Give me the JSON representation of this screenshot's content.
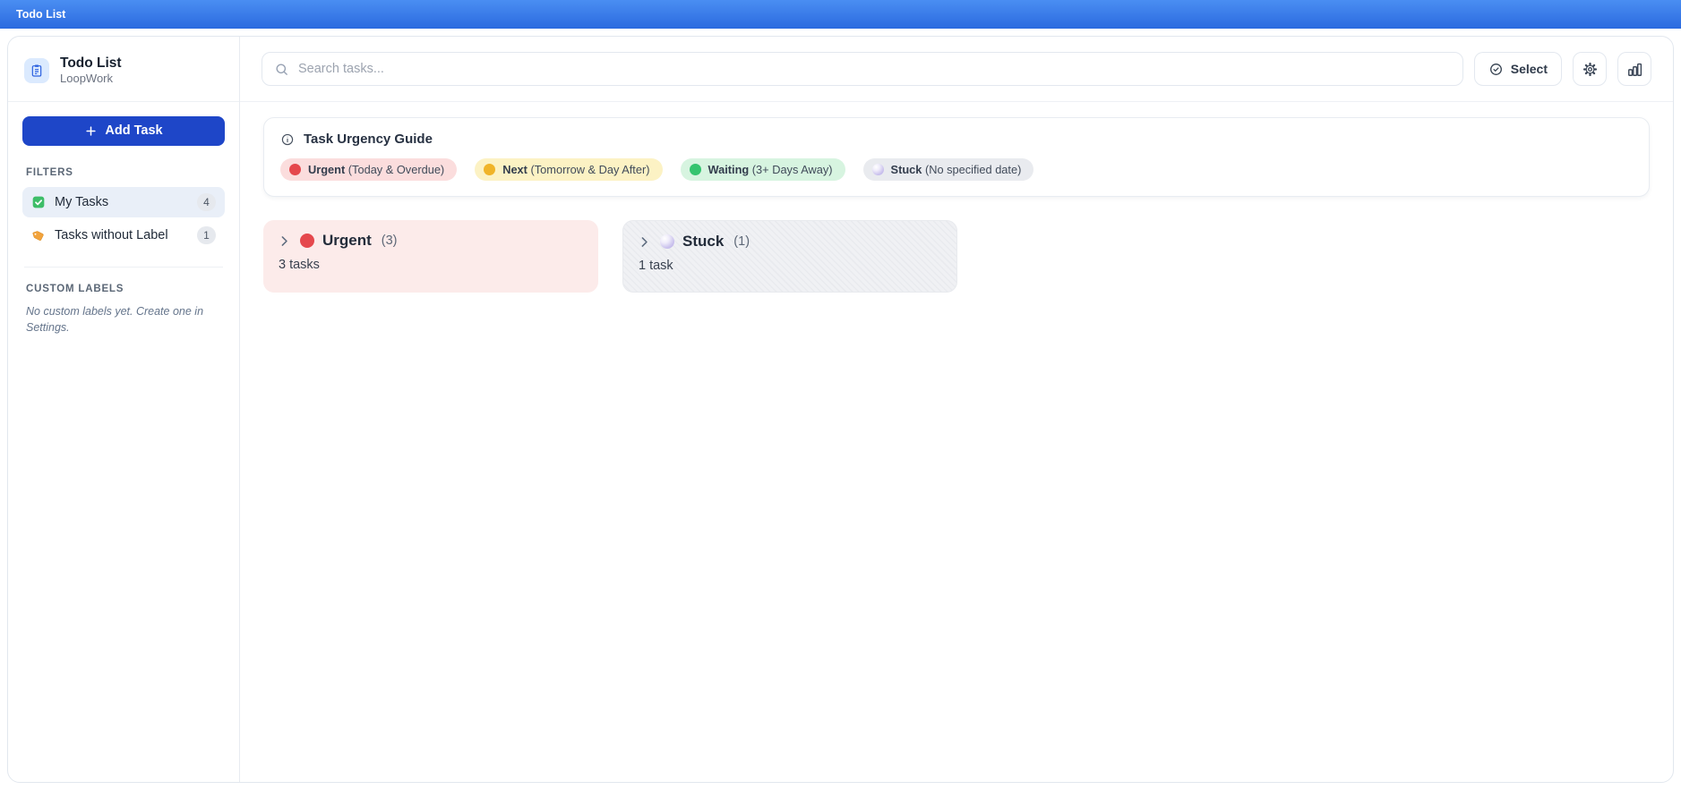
{
  "window": {
    "title": "Todo List"
  },
  "sidebar": {
    "app_title": "Todo List",
    "app_subtitle": "LoopWork",
    "add_task_label": "Add Task",
    "filters_heading": "FILTERS",
    "filters": [
      {
        "label": "My Tasks",
        "count": "4",
        "icon": "green-checkbox-icon",
        "selected": true
      },
      {
        "label": "Tasks without Label",
        "count": "1",
        "icon": "orange-tag-icon",
        "selected": false
      }
    ],
    "custom_labels_heading": "CUSTOM LABELS",
    "custom_labels_empty": "No custom labels yet. Create one in Settings."
  },
  "toolbar": {
    "search_placeholder": "Search tasks...",
    "search_value": "",
    "select_label": "Select",
    "icon_buttons": [
      "settings-gear-icon",
      "stats-bar-chart-icon"
    ]
  },
  "urgency_guide": {
    "title": "Task Urgency Guide",
    "legend": [
      {
        "name": "Urgent",
        "desc": "(Today & Overdue)",
        "dot_color": "#e5484d",
        "bg_color": "#fbdddd"
      },
      {
        "name": "Next",
        "desc": "(Tomorrow & Day After)",
        "dot_color": "#f0b429",
        "bg_color": "#fcf2c4"
      },
      {
        "name": "Waiting",
        "desc": "(3+ Days Away)",
        "dot_color": "#35c46f",
        "bg_color": "#d7f4e0"
      },
      {
        "name": "Stuck",
        "desc": "(No specified date)",
        "dot_color": "moon",
        "bg_color": "#e9ebef"
      }
    ]
  },
  "groups": [
    {
      "name": "Urgent",
      "count": "(3)",
      "summary": "3 tasks",
      "dot_color": "#e5484d",
      "bg_color": "#fcebea"
    },
    {
      "name": "Stuck",
      "count": "(1)",
      "summary": "1 task",
      "dot_color": "moon",
      "bg_color": "#f0f1f4"
    }
  ],
  "colors": {
    "titlebar_gradient_top": "#4a8ef2",
    "titlebar_gradient_bottom": "#2b6adf",
    "add_task_button": "#1e46c8",
    "selected_filter_bg": "#e9eff8"
  }
}
